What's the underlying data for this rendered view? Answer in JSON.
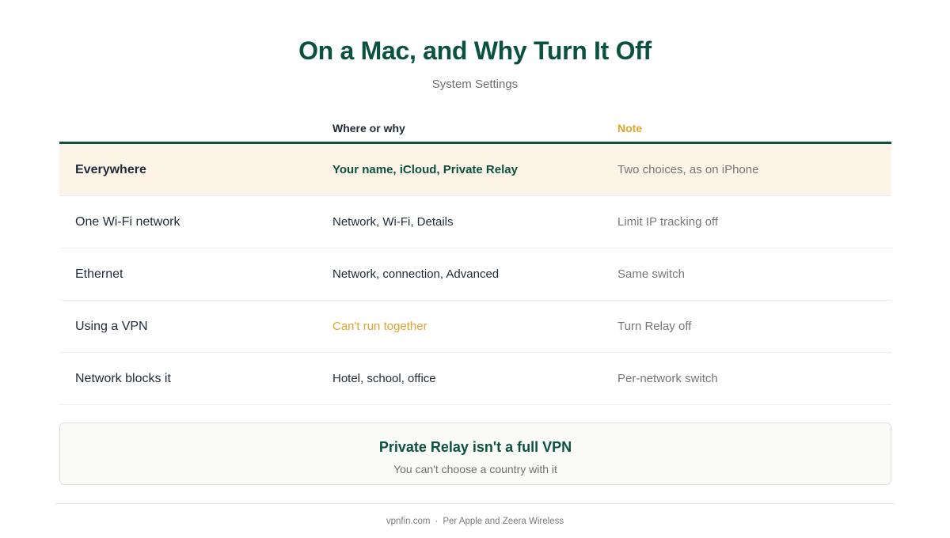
{
  "header": {
    "title": "On a Mac, and Why Turn It Off",
    "subtitle": "System Settings"
  },
  "table": {
    "columns": [
      "",
      "Where or why",
      "Note"
    ],
    "rows": [
      {
        "label": "Everywhere",
        "where": "Your name, iCloud, Private Relay",
        "note": "Two choices, as on iPhone"
      },
      {
        "label": "One Wi-Fi network",
        "where": "Network, Wi-Fi, Details",
        "note": "Limit IP tracking off"
      },
      {
        "label": "Ethernet",
        "where": "Network, connection, Advanced",
        "note": "Same switch"
      },
      {
        "label": "Using a VPN",
        "where": "Can't run together",
        "note": "Turn Relay off"
      },
      {
        "label": "Network blocks it",
        "where": "Hotel, school, office",
        "note": "Per-network switch"
      }
    ]
  },
  "callout": {
    "title": "Private Relay isn't a full VPN",
    "subtitle": "You can't choose a country with it"
  },
  "footer": {
    "site": "vpnfin.com",
    "separator": "·",
    "source": "Per Apple and Zeera Wireless"
  },
  "colors": {
    "brand_green": "#0b5140",
    "accent_amber": "#e0a52a",
    "highlight_row": "#fdf4e7"
  }
}
